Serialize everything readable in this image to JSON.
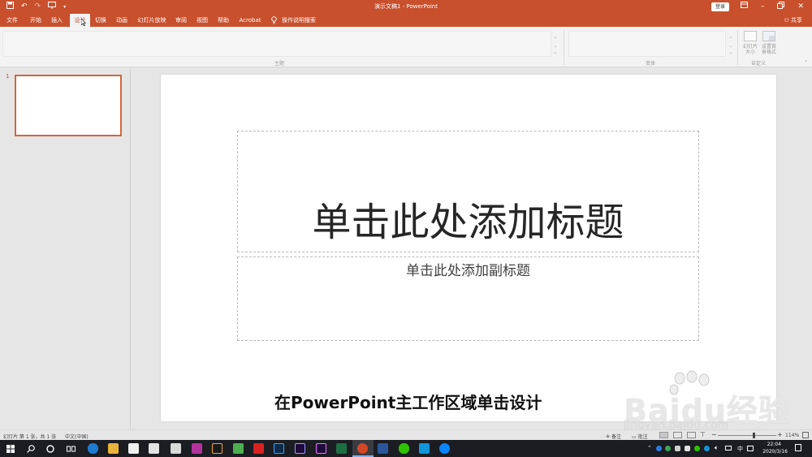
{
  "titlebar": {
    "title": "演示文稿1  -  PowerPoint",
    "login": "登录",
    "qat_icons": [
      "save-icon",
      "undo-icon",
      "redo-icon",
      "start-from-beginning-icon",
      "customize-qat-icon"
    ],
    "window_controls": [
      "ribbon-display-options-icon",
      "minimize-icon",
      "restore-icon",
      "close-icon"
    ]
  },
  "tabs": [
    {
      "label": "文件"
    },
    {
      "label": "开始"
    },
    {
      "label": "插入"
    },
    {
      "label": "设计"
    },
    {
      "label": "切换"
    },
    {
      "label": "动画"
    },
    {
      "label": "幻灯片放映"
    },
    {
      "label": "审阅"
    },
    {
      "label": "视图"
    },
    {
      "label": "帮助"
    },
    {
      "label": "Acrobat"
    },
    {
      "label": "操作说明搜索"
    }
  ],
  "active_tab": "设计",
  "share_label": "共享",
  "ribbon": {
    "group_themes": "主题",
    "group_variants": "变体",
    "group_customize": "自定义",
    "slide_size_label": "幻灯片\n大小",
    "format_bg_label": "设置背\n景格式"
  },
  "thumbnails": [
    {
      "number": "1"
    }
  ],
  "slide": {
    "title_placeholder": "单击此处添加标题",
    "subtitle_placeholder": "单击此处添加副标题"
  },
  "caption": "在PowerPoint主工作区域单击设计",
  "watermark": {
    "text": "Baidu经验",
    "url": "jingyan.baidu.com"
  },
  "statusbar": {
    "slide_info": "幻灯片 第 1 张，共 1 张",
    "language": "中文(中国)",
    "notes": "备注",
    "comments": "批注",
    "zoom": "114%"
  },
  "taskbar": {
    "time": "22:04",
    "date": "2020/3/16"
  },
  "colors": {
    "accent": "#c8502d",
    "taskbar": "#1c1d22"
  }
}
